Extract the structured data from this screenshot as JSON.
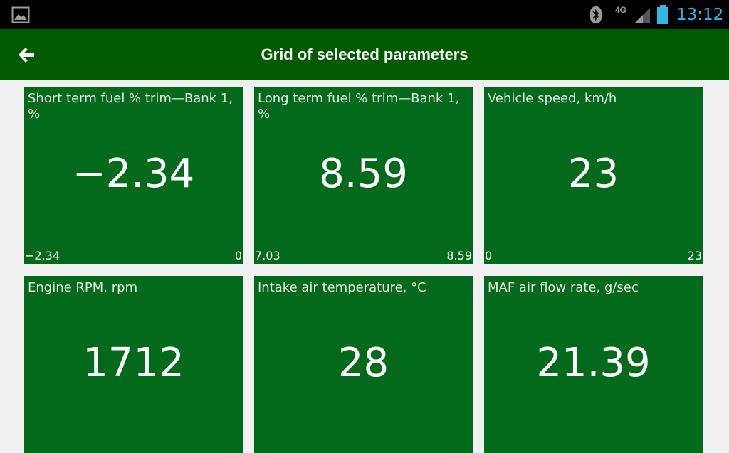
{
  "status_bar": {
    "icons": [
      "gallery-icon",
      "bluetooth-icon",
      "signal-icon",
      "battery-icon"
    ],
    "network": "4G",
    "time": "13:12",
    "colors": {
      "time": "#33b5e5",
      "icons": "#9a9a9a"
    }
  },
  "app_bar": {
    "title": "Grid of selected parameters",
    "back_icon": "arrow-left-icon",
    "background": "#005a00"
  },
  "tiles": [
    {
      "label": "Short term fuel % trim—Bank 1, %",
      "value": "−2.34",
      "min": "−2.34",
      "max": "0"
    },
    {
      "label": "Long term fuel % trim—Bank 1, %",
      "value": "8.59",
      "min": "7.03",
      "max": "8.59"
    },
    {
      "label": "Vehicle speed, km/h",
      "value": "23",
      "min": "0",
      "max": "23"
    },
    {
      "label": "Engine RPM, rpm",
      "value": "1712",
      "min": "",
      "max": ""
    },
    {
      "label": "Intake air temperature, °C",
      "value": "28",
      "min": "",
      "max": ""
    },
    {
      "label": "MAF air flow rate, g/sec",
      "value": "21.39",
      "min": "",
      "max": ""
    }
  ],
  "colors": {
    "tile_background": "#046a1b",
    "page_background": "#f1f1f1"
  }
}
